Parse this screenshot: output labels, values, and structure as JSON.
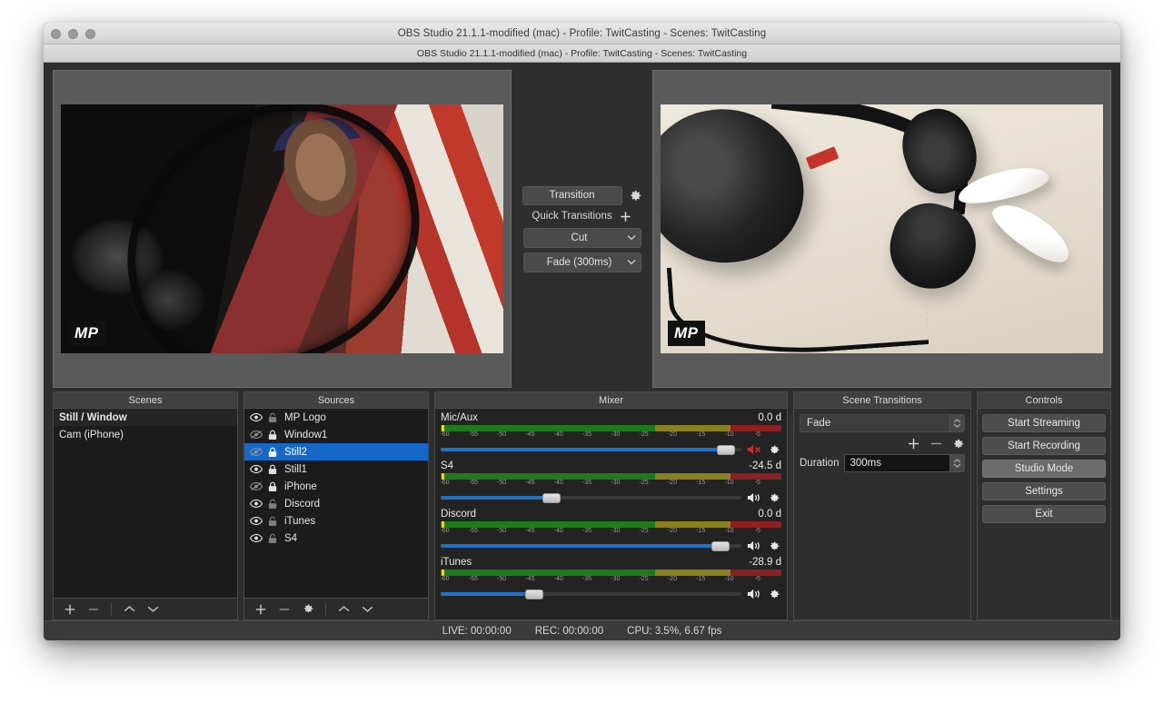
{
  "window": {
    "title": "OBS Studio 21.1.1-modified (mac) - Profile: TwitCasting - Scenes: TwitCasting",
    "menu_strip_title": "OBS Studio 21.1.1-modified (mac) - Profile: TwitCasting - Scenes: TwitCasting"
  },
  "preview": {
    "program_watermark": "MP",
    "preview_watermark": "MP"
  },
  "transition_center": {
    "transition_button": "Transition",
    "gear_icon": "gear-icon",
    "quick_transitions_label": "Quick Transitions",
    "add_icon": "plus-icon",
    "quick_1": "Cut",
    "quick_2": "Fade (300ms)"
  },
  "scenes": {
    "title": "Scenes",
    "items": [
      {
        "label": "Still / Window",
        "active": true
      },
      {
        "label": "Cam (iPhone)",
        "active": false
      }
    ],
    "toolbar": [
      "plus-icon",
      "minus-icon",
      "chevron-up-icon",
      "chevron-down-icon"
    ]
  },
  "sources": {
    "title": "Sources",
    "items": [
      {
        "label": "MP Logo",
        "visible": true,
        "locked": false,
        "selected": false
      },
      {
        "label": "Window1",
        "visible": false,
        "locked": true,
        "selected": false
      },
      {
        "label": "Still2",
        "visible": false,
        "locked": true,
        "selected": true
      },
      {
        "label": "Still1",
        "visible": true,
        "locked": true,
        "selected": false
      },
      {
        "label": "iPhone",
        "visible": false,
        "locked": true,
        "selected": false
      },
      {
        "label": "Discord",
        "visible": true,
        "locked": false,
        "selected": false
      },
      {
        "label": "iTunes",
        "visible": true,
        "locked": false,
        "selected": false
      },
      {
        "label": "S4",
        "visible": true,
        "locked": false,
        "selected": false
      }
    ],
    "toolbar": [
      "plus-icon",
      "minus-icon",
      "gear-icon",
      "chevron-up-icon",
      "chevron-down-icon"
    ]
  },
  "mixer": {
    "title": "Mixer",
    "scale_ticks": [
      "-60",
      "-55",
      "-50",
      "-45",
      "-40",
      "-35",
      "-30",
      "-25",
      "-20",
      "-15",
      "-10",
      "-5"
    ],
    "channels": [
      {
        "name": "Mic/Aux",
        "db": "0.0 d",
        "volume_pct": 95,
        "muted": true,
        "meter_pct": 0
      },
      {
        "name": "S4",
        "db": "-24.5 d",
        "volume_pct": 37,
        "muted": false,
        "meter_pct": 0
      },
      {
        "name": "Discord",
        "db": "0.0 d",
        "volume_pct": 93,
        "muted": false,
        "meter_pct": 0
      },
      {
        "name": "iTunes",
        "db": "-28.9 d",
        "volume_pct": 31,
        "muted": false,
        "meter_pct": 0
      }
    ]
  },
  "scene_transitions": {
    "title": "Scene Transitions",
    "transition_value": "Fade",
    "add_icon": "plus-icon",
    "remove_icon": "minus-icon",
    "properties_icon": "gear-icon",
    "duration_label": "Duration",
    "duration_value": "300ms"
  },
  "controls": {
    "title": "Controls",
    "buttons": [
      {
        "label": "Start Streaming",
        "active": false
      },
      {
        "label": "Start Recording",
        "active": false
      },
      {
        "label": "Studio Mode",
        "active": true
      },
      {
        "label": "Settings",
        "active": false
      },
      {
        "label": "Exit",
        "active": false
      }
    ]
  },
  "statusbar": {
    "live": "LIVE: 00:00:00",
    "rec": "REC: 00:00:00",
    "cpu": "CPU: 3.5%, 6.67 fps"
  },
  "colors": {
    "accent_blue": "#1568c8",
    "slider_blue": "#1e72c8",
    "meter_green": "#1d7a1d",
    "meter_yellow": "#8a8020",
    "meter_red": "#8c1f1f",
    "mute_red": "#d02b28"
  }
}
